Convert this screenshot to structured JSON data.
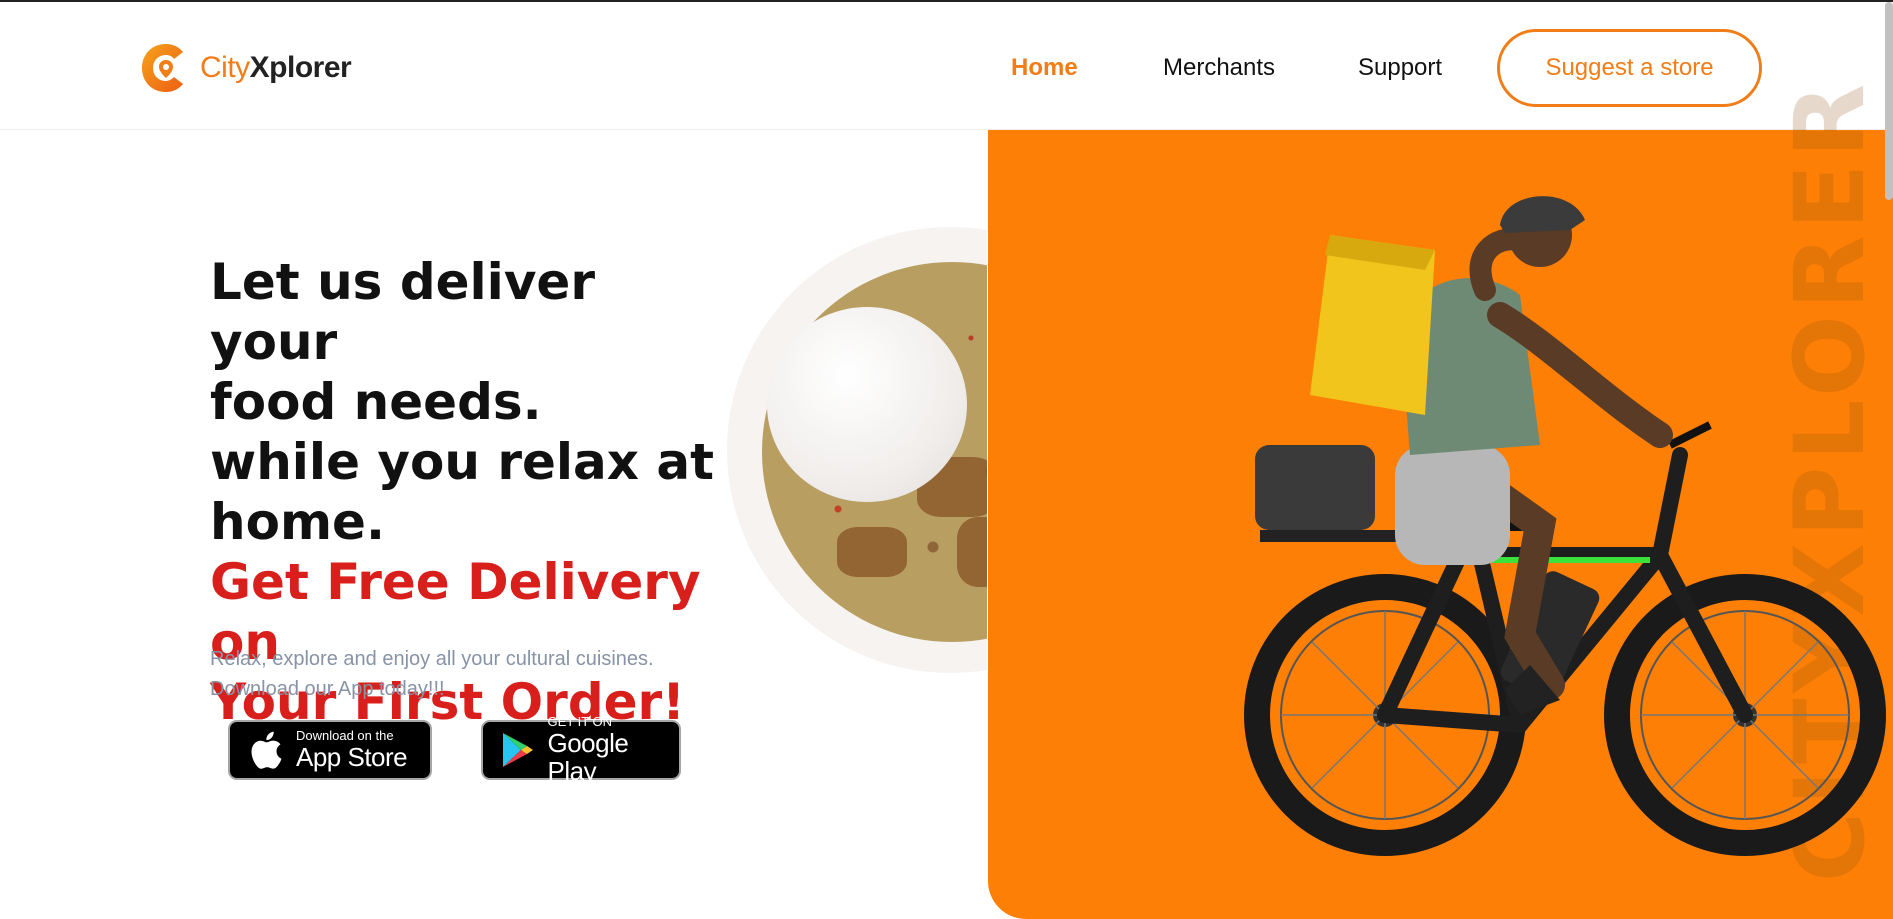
{
  "brand": {
    "name_part1": "City",
    "name_part2": "Xplorer",
    "accent_color": "#f07d17",
    "icon": "location-pin-icon"
  },
  "nav": {
    "items": [
      {
        "label": "Home",
        "active": true
      },
      {
        "label": "Merchants",
        "active": false
      },
      {
        "label": "Support",
        "active": false
      }
    ],
    "cta_label": "Suggest a store"
  },
  "hero": {
    "title_lines": [
      "Let us deliver your",
      "food needs.",
      "while you relax at",
      "home."
    ],
    "highlight_lines": [
      "Get Free Delivery on",
      "Your First Order!"
    ],
    "highlight_color": "#d81f1b",
    "subtitle_lines": [
      "Relax, explore and enjoy all your cultural cuisines.",
      "Download our App today!!!"
    ]
  },
  "stores": {
    "apple": {
      "small": "Download on the",
      "big": "App Store",
      "icon": "apple-icon"
    },
    "google": {
      "small": "GET IT ON",
      "big": "Google Play",
      "icon": "google-play-icon"
    }
  },
  "panel": {
    "background_color": "#fd7f05",
    "watermark": "CITYXPLORER"
  }
}
